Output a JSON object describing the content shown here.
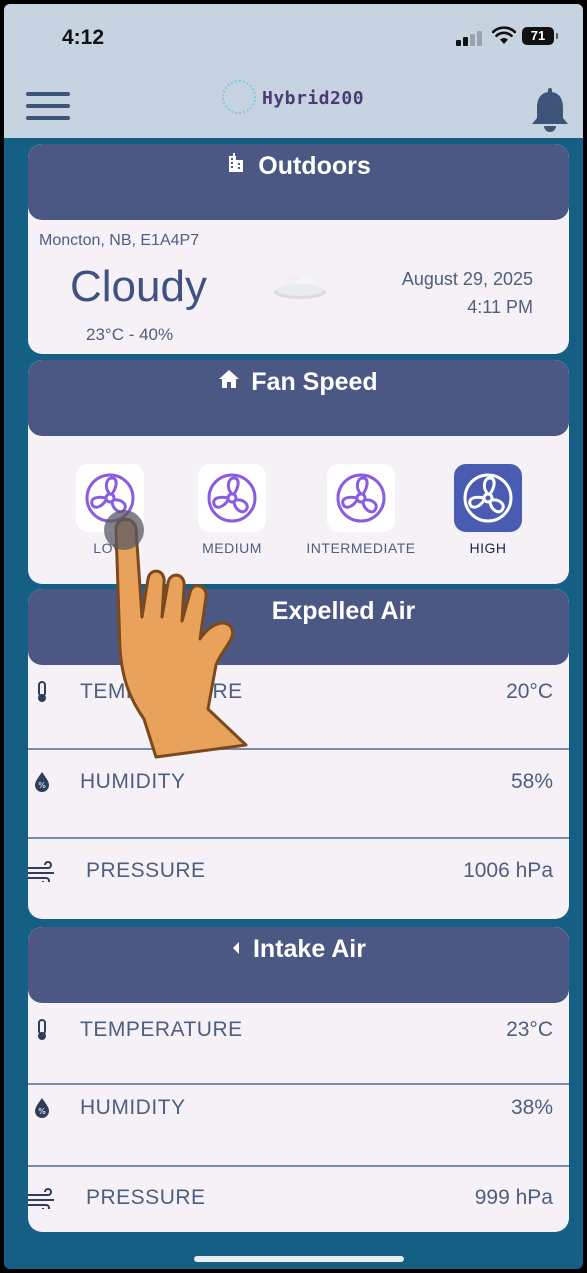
{
  "status": {
    "time": "4:12",
    "battery": "71"
  },
  "header": {
    "app_name": "Hybrid200"
  },
  "outdoors": {
    "title": "Outdoors",
    "location": "Moncton, NB, E1A4P7",
    "condition": "Cloudy",
    "temp_humidity": "23°C - 40%",
    "date": "August 29, 2025",
    "time": "4:11 PM"
  },
  "fan_speed": {
    "title": "Fan Speed",
    "options": [
      {
        "label": "LOW",
        "selected": false
      },
      {
        "label": "MEDIUM",
        "selected": false
      },
      {
        "label": "INTERMEDIATE",
        "selected": false
      },
      {
        "label": "HIGH",
        "selected": true
      }
    ]
  },
  "expelled_air": {
    "title": "Expelled Air",
    "rows": [
      {
        "label": "TEMPERATURE",
        "value": "20°C",
        "icon": "thermometer-icon"
      },
      {
        "label": "HUMIDITY",
        "value": "58%",
        "icon": "humidity-icon"
      },
      {
        "label": "PRESSURE",
        "value": "1006 hPa",
        "icon": "wind-icon"
      }
    ]
  },
  "intake_air": {
    "title": "Intake Air",
    "rows": [
      {
        "label": "TEMPERATURE",
        "value": "23°C",
        "icon": "thermometer-icon"
      },
      {
        "label": "HUMIDITY",
        "value": "38%",
        "icon": "humidity-icon"
      },
      {
        "label": "PRESSURE",
        "value": "999 hPa",
        "icon": "wind-icon"
      }
    ]
  },
  "colors": {
    "background": "#155f85",
    "card_header": "#4a5883",
    "card_body": "#f5f1f7",
    "fan_active": "#4a5cb2",
    "fan_icon": "#8a5ce0"
  }
}
